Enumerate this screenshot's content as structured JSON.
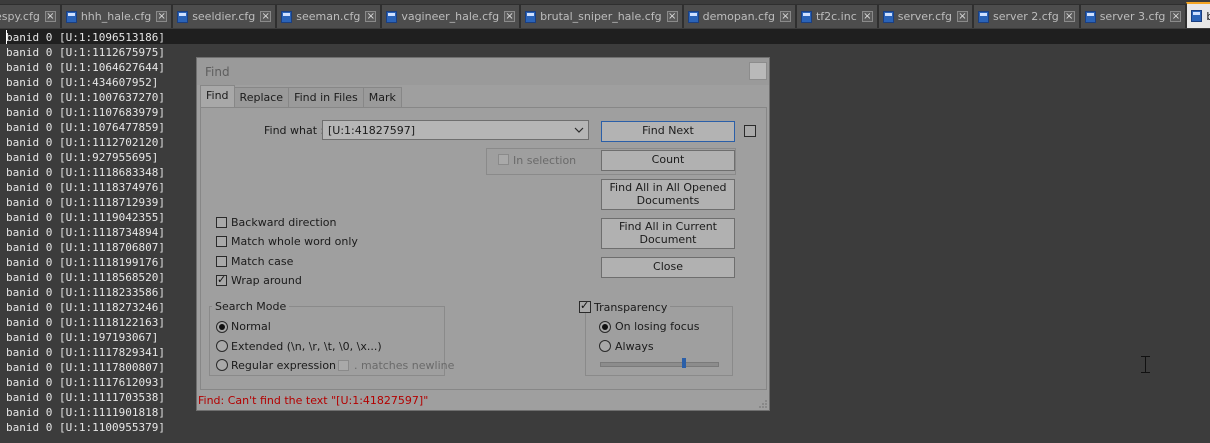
{
  "tabs": [
    {
      "label": "espy.cfg",
      "active": false
    },
    {
      "label": "hhh_hale.cfg",
      "active": false
    },
    {
      "label": "seeldier.cfg",
      "active": false
    },
    {
      "label": "seeman.cfg",
      "active": false
    },
    {
      "label": "vagineer_hale.cfg",
      "active": false
    },
    {
      "label": "brutal_sniper_hale.cfg",
      "active": false
    },
    {
      "label": "demopan.cfg",
      "active": false
    },
    {
      "label": "tf2c.inc",
      "active": false
    },
    {
      "label": "server.cfg",
      "active": false
    },
    {
      "label": "server 2.cfg",
      "active": false
    },
    {
      "label": "server 3.cfg",
      "active": false
    },
    {
      "label": "banned_user.cfg",
      "active": true
    }
  ],
  "editor": {
    "lines": [
      "banid 0 [U:1:1096513186]",
      "banid 0 [U:1:1112675975]",
      "banid 0 [U:1:1064627644]",
      "banid 0 [U:1:434607952]",
      "banid 0 [U:1:1007637270]",
      "banid 0 [U:1:1107683979]",
      "banid 0 [U:1:1076477859]",
      "banid 0 [U:1:1112702120]",
      "banid 0 [U:1:927955695]",
      "banid 0 [U:1:1118683348]",
      "banid 0 [U:1:1118374976]",
      "banid 0 [U:1:1118712939]",
      "banid 0 [U:1:1119042355]",
      "banid 0 [U:1:1118734894]",
      "banid 0 [U:1:1118706807]",
      "banid 0 [U:1:1118199176]",
      "banid 0 [U:1:1118568520]",
      "banid 0 [U:1:1118233586]",
      "banid 0 [U:1:1118273246]",
      "banid 0 [U:1:1118122163]",
      "banid 0 [U:1:197193067]",
      "banid 0 [U:1:1117829341]",
      "banid 0 [U:1:1117800807]",
      "banid 0 [U:1:1117612093]",
      "banid 0 [U:1:1111703538]",
      "banid 0 [U:1:1111901818]",
      "banid 0 [U:1:1100955379]"
    ]
  },
  "dialog": {
    "title": "Find",
    "tabs": [
      "Find",
      "Replace",
      "Find in Files",
      "Mark"
    ],
    "find_what_label": "Find what :",
    "find_what_value": "[U:1:41827597]",
    "in_selection_label": "In selection",
    "buttons": {
      "find_next": "Find Next",
      "count": "Count",
      "find_all_opened_line1": "Find All in All Opened",
      "find_all_opened_line2": "Documents",
      "find_all_current_line1": "Find All in Current",
      "find_all_current_line2": "Document",
      "close": "Close"
    },
    "options": {
      "backward": {
        "label": "Backward direction",
        "checked": false
      },
      "whole_word": {
        "label": "Match whole word only",
        "checked": false
      },
      "match_case": {
        "label": "Match case",
        "checked": false
      },
      "wrap_around": {
        "label": "Wrap around",
        "checked": true
      }
    },
    "search_mode": {
      "title": "Search Mode",
      "normal": "Normal",
      "extended": "Extended (\\n, \\r, \\t, \\0, \\x...)",
      "regex": "Regular expression",
      "matches_newline": ". matches newline",
      "selected": "Normal"
    },
    "transparency": {
      "label": "Transparency",
      "checked": true,
      "on_losing_focus": "On losing focus",
      "always": "Always",
      "selected": "On losing focus",
      "level": 0.72
    },
    "status": "Find: Can't find the text \"[U:1:41827597]\""
  },
  "colors": {
    "status_red": "#b30000",
    "active_tab_accent": "#f5a623",
    "close_icon_red": "#c0392b"
  }
}
